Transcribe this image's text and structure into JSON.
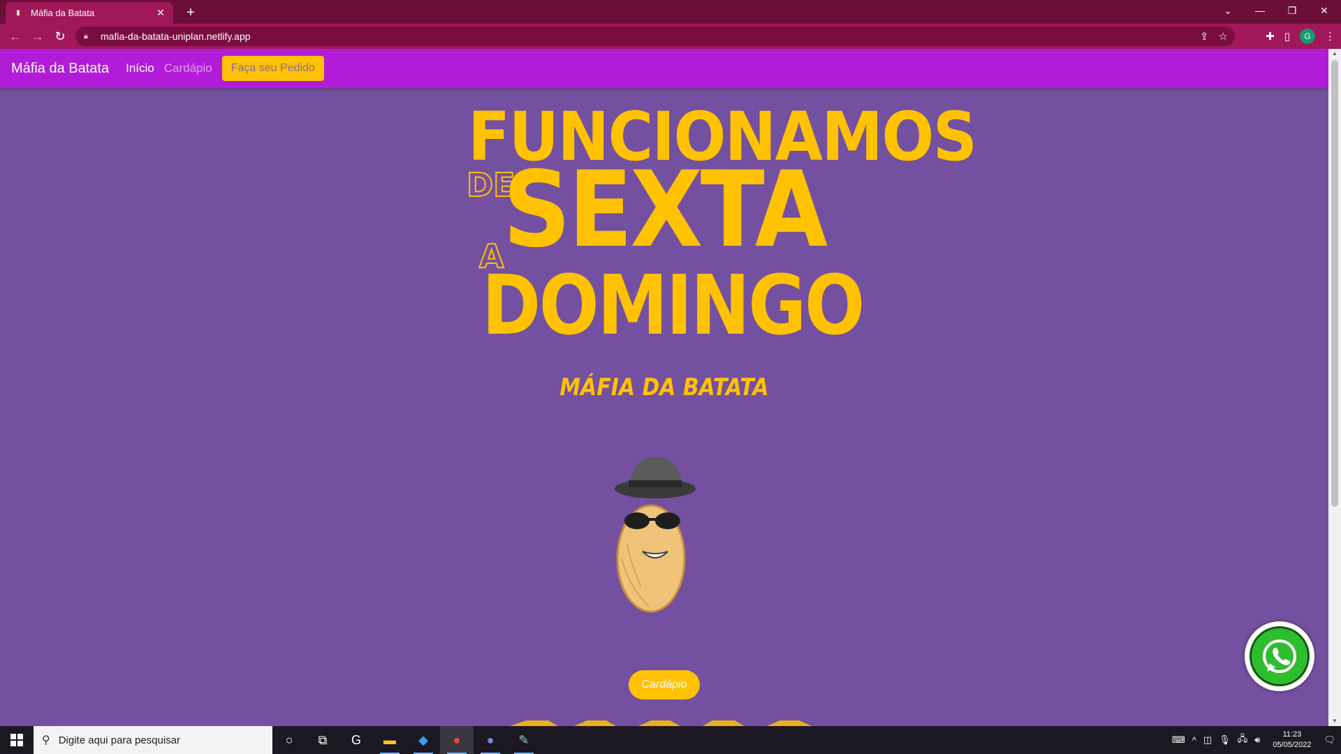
{
  "browser": {
    "tab_title": "Máfia da Batata",
    "url": "mafia-da-batata-uniplan.netlify.app",
    "profile_initial": "G"
  },
  "site": {
    "brand": "Máfia da Batata",
    "nav": {
      "home": "Início",
      "menu": "Cardápio",
      "order": "Faça seu Pedido"
    },
    "hero": {
      "line1": "FUNCIONAMOS",
      "de": "DE",
      "line2": "SEXTA",
      "a": "A",
      "line3": "DOMINGO"
    },
    "subtitle": "MÁFIA DA BATATA",
    "menu_button": "Cardápio"
  },
  "taskbar": {
    "search_placeholder": "Digite aqui para pesquisar",
    "time": "11:23",
    "date": "05/05/2022"
  },
  "colors": {
    "page_bg": "#7450a0",
    "navbar": "#b21cd8",
    "accent_yellow": "#ffc200",
    "chrome_tab": "#a0185a",
    "whatsapp": "#2ebd2e"
  }
}
